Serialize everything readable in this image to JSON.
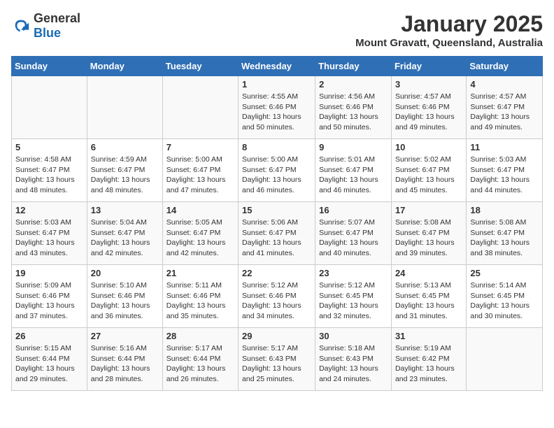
{
  "header": {
    "logo_general": "General",
    "logo_blue": "Blue",
    "title": "January 2025",
    "subtitle": "Mount Gravatt, Queensland, Australia"
  },
  "columns": [
    "Sunday",
    "Monday",
    "Tuesday",
    "Wednesday",
    "Thursday",
    "Friday",
    "Saturday"
  ],
  "weeks": [
    [
      {
        "day": "",
        "info": ""
      },
      {
        "day": "",
        "info": ""
      },
      {
        "day": "",
        "info": ""
      },
      {
        "day": "1",
        "info": "Sunrise: 4:55 AM\nSunset: 6:46 PM\nDaylight: 13 hours\nand 50 minutes."
      },
      {
        "day": "2",
        "info": "Sunrise: 4:56 AM\nSunset: 6:46 PM\nDaylight: 13 hours\nand 50 minutes."
      },
      {
        "day": "3",
        "info": "Sunrise: 4:57 AM\nSunset: 6:46 PM\nDaylight: 13 hours\nand 49 minutes."
      },
      {
        "day": "4",
        "info": "Sunrise: 4:57 AM\nSunset: 6:47 PM\nDaylight: 13 hours\nand 49 minutes."
      }
    ],
    [
      {
        "day": "5",
        "info": "Sunrise: 4:58 AM\nSunset: 6:47 PM\nDaylight: 13 hours\nand 48 minutes."
      },
      {
        "day": "6",
        "info": "Sunrise: 4:59 AM\nSunset: 6:47 PM\nDaylight: 13 hours\nand 48 minutes."
      },
      {
        "day": "7",
        "info": "Sunrise: 5:00 AM\nSunset: 6:47 PM\nDaylight: 13 hours\nand 47 minutes."
      },
      {
        "day": "8",
        "info": "Sunrise: 5:00 AM\nSunset: 6:47 PM\nDaylight: 13 hours\nand 46 minutes."
      },
      {
        "day": "9",
        "info": "Sunrise: 5:01 AM\nSunset: 6:47 PM\nDaylight: 13 hours\nand 46 minutes."
      },
      {
        "day": "10",
        "info": "Sunrise: 5:02 AM\nSunset: 6:47 PM\nDaylight: 13 hours\nand 45 minutes."
      },
      {
        "day": "11",
        "info": "Sunrise: 5:03 AM\nSunset: 6:47 PM\nDaylight: 13 hours\nand 44 minutes."
      }
    ],
    [
      {
        "day": "12",
        "info": "Sunrise: 5:03 AM\nSunset: 6:47 PM\nDaylight: 13 hours\nand 43 minutes."
      },
      {
        "day": "13",
        "info": "Sunrise: 5:04 AM\nSunset: 6:47 PM\nDaylight: 13 hours\nand 42 minutes."
      },
      {
        "day": "14",
        "info": "Sunrise: 5:05 AM\nSunset: 6:47 PM\nDaylight: 13 hours\nand 42 minutes."
      },
      {
        "day": "15",
        "info": "Sunrise: 5:06 AM\nSunset: 6:47 PM\nDaylight: 13 hours\nand 41 minutes."
      },
      {
        "day": "16",
        "info": "Sunrise: 5:07 AM\nSunset: 6:47 PM\nDaylight: 13 hours\nand 40 minutes."
      },
      {
        "day": "17",
        "info": "Sunrise: 5:08 AM\nSunset: 6:47 PM\nDaylight: 13 hours\nand 39 minutes."
      },
      {
        "day": "18",
        "info": "Sunrise: 5:08 AM\nSunset: 6:47 PM\nDaylight: 13 hours\nand 38 minutes."
      }
    ],
    [
      {
        "day": "19",
        "info": "Sunrise: 5:09 AM\nSunset: 6:46 PM\nDaylight: 13 hours\nand 37 minutes."
      },
      {
        "day": "20",
        "info": "Sunrise: 5:10 AM\nSunset: 6:46 PM\nDaylight: 13 hours\nand 36 minutes."
      },
      {
        "day": "21",
        "info": "Sunrise: 5:11 AM\nSunset: 6:46 PM\nDaylight: 13 hours\nand 35 minutes."
      },
      {
        "day": "22",
        "info": "Sunrise: 5:12 AM\nSunset: 6:46 PM\nDaylight: 13 hours\nand 34 minutes."
      },
      {
        "day": "23",
        "info": "Sunrise: 5:12 AM\nSunset: 6:45 PM\nDaylight: 13 hours\nand 32 minutes."
      },
      {
        "day": "24",
        "info": "Sunrise: 5:13 AM\nSunset: 6:45 PM\nDaylight: 13 hours\nand 31 minutes."
      },
      {
        "day": "25",
        "info": "Sunrise: 5:14 AM\nSunset: 6:45 PM\nDaylight: 13 hours\nand 30 minutes."
      }
    ],
    [
      {
        "day": "26",
        "info": "Sunrise: 5:15 AM\nSunset: 6:44 PM\nDaylight: 13 hours\nand 29 minutes."
      },
      {
        "day": "27",
        "info": "Sunrise: 5:16 AM\nSunset: 6:44 PM\nDaylight: 13 hours\nand 28 minutes."
      },
      {
        "day": "28",
        "info": "Sunrise: 5:17 AM\nSunset: 6:44 PM\nDaylight: 13 hours\nand 26 minutes."
      },
      {
        "day": "29",
        "info": "Sunrise: 5:17 AM\nSunset: 6:43 PM\nDaylight: 13 hours\nand 25 minutes."
      },
      {
        "day": "30",
        "info": "Sunrise: 5:18 AM\nSunset: 6:43 PM\nDaylight: 13 hours\nand 24 minutes."
      },
      {
        "day": "31",
        "info": "Sunrise: 5:19 AM\nSunset: 6:42 PM\nDaylight: 13 hours\nand 23 minutes."
      },
      {
        "day": "",
        "info": ""
      }
    ]
  ]
}
